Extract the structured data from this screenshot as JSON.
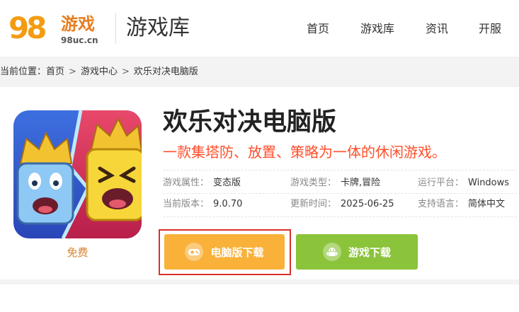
{
  "header": {
    "logo_number": "98",
    "logo_cn": "游戏",
    "logo_url": "98uc.cn",
    "section_title": "游戏库",
    "nav": [
      "首页",
      "游戏库",
      "资讯",
      "开服"
    ]
  },
  "breadcrumb": {
    "prefix": "当前位置：",
    "items": [
      "首页",
      "游戏中心",
      "欢乐对决电脑版"
    ],
    "separator": ">"
  },
  "game": {
    "title": "欢乐对决电脑版",
    "slogan": "一款集塔防、放置、策略为一体的休闲游戏。",
    "price": "免费",
    "info": [
      {
        "label": "游戏属性：",
        "value": "变态版"
      },
      {
        "label": "游戏类型：",
        "value": "卡牌,冒险"
      },
      {
        "label": "运行平台：",
        "value": "Windows"
      },
      {
        "label": "当前版本：",
        "value": "9.0.70"
      },
      {
        "label": "更新时间：",
        "value": "2025-06-25"
      },
      {
        "label": "支持语言：",
        "value": "简体中文"
      }
    ]
  },
  "buttons": {
    "pc_download": "电脑版下载",
    "game_download": "游戏下载"
  },
  "colors": {
    "slogan": "#ff4e2a",
    "pc_button": "#f9b13a",
    "game_button": "#8bc33a",
    "highlight": "#d8312b",
    "logo_orange": "#f39c12",
    "logo_blue": "#2e86de"
  },
  "icons": {
    "pc_button_icon": "gamepad-icon",
    "game_button_icon": "android-icon"
  }
}
